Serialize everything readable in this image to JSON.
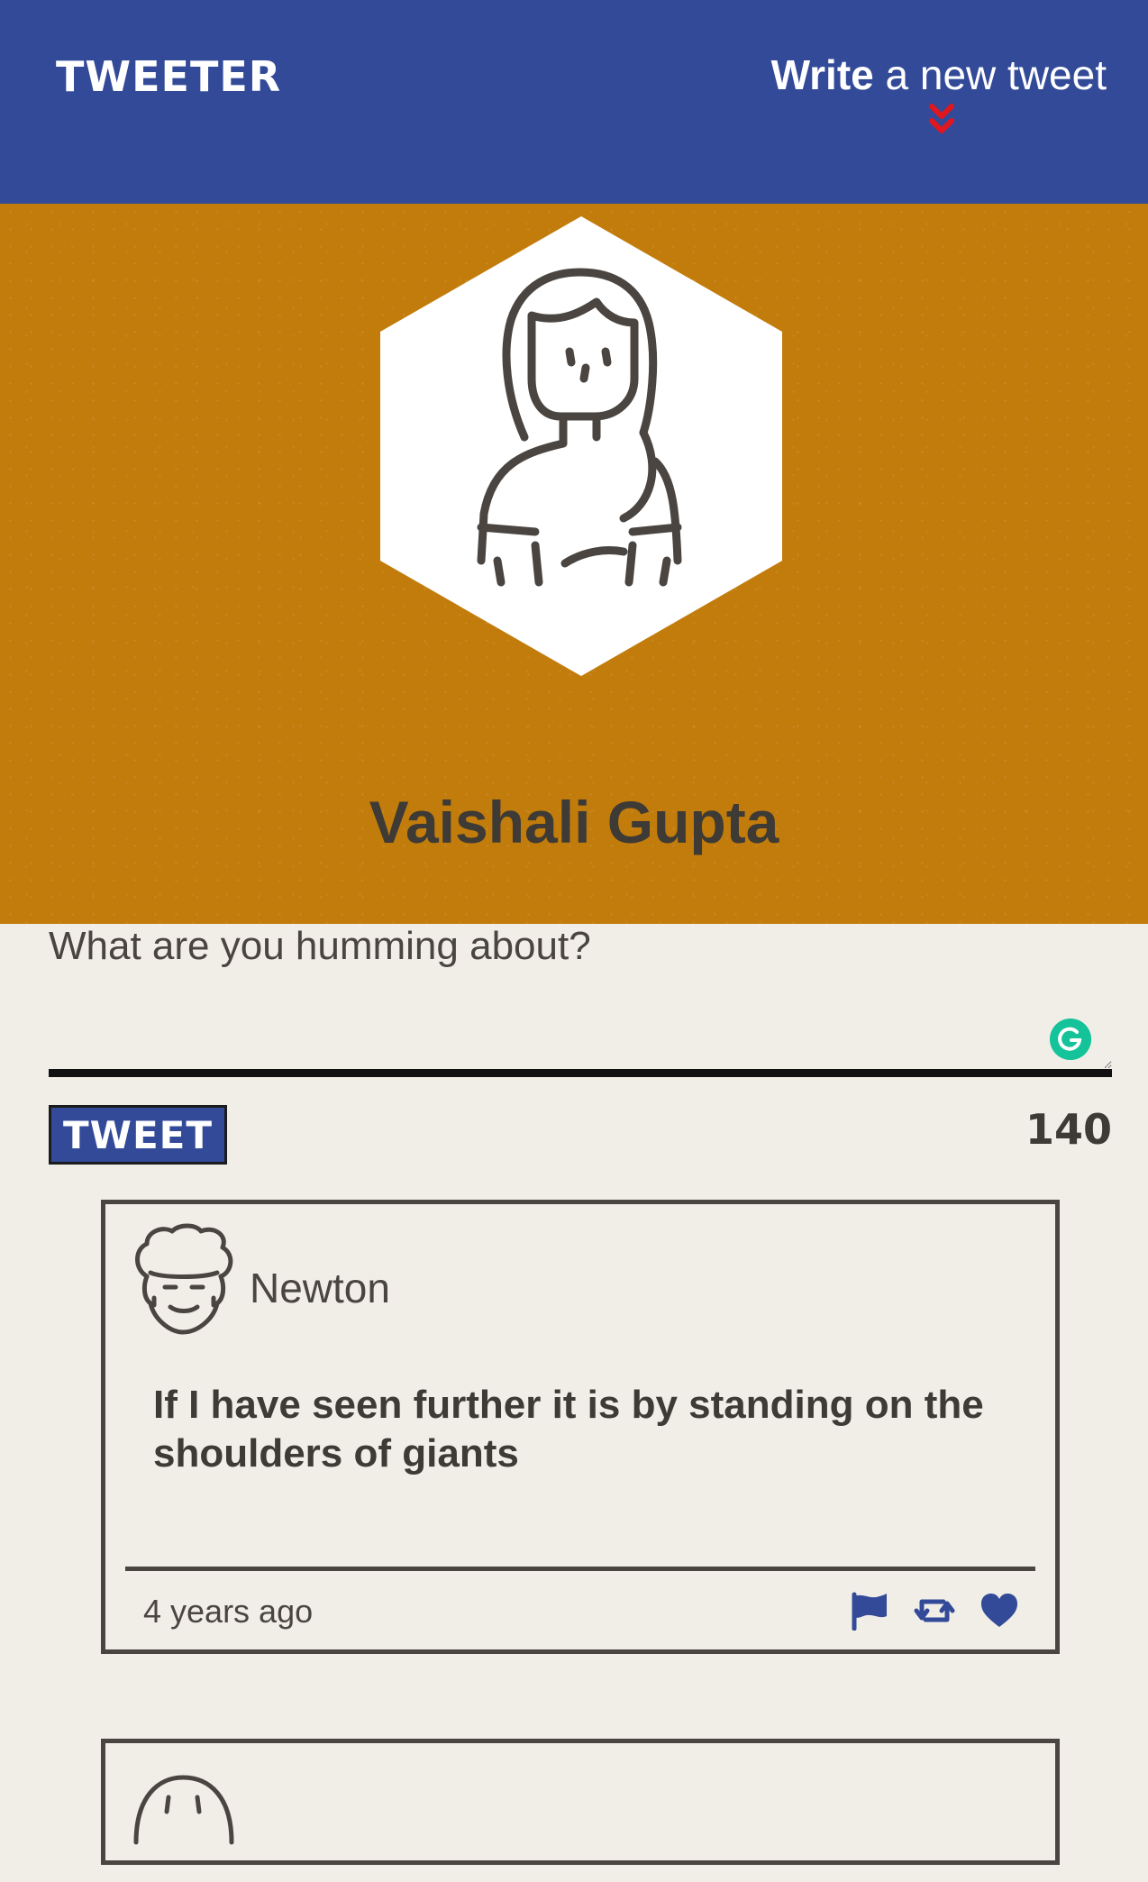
{
  "nav": {
    "brand": "TWEETER",
    "compose_toggle": {
      "strong": "Write",
      "light": " a new tweet",
      "icon": "double-chevron-down-icon",
      "icon_color": "#e0171e"
    },
    "background": "#324a98"
  },
  "profile": {
    "name": "Vaishali Gupta",
    "avatar_icon": "woman-avatar-icon",
    "background": "#c27c0c"
  },
  "compose": {
    "placeholder": "What are you humming about?",
    "value": "",
    "tweet_button": "TWEET",
    "char_counter": "140",
    "grammarly_icon": "grammarly-icon"
  },
  "tweets": [
    {
      "author": "Newton",
      "avatar_icon": "curly-hair-man-avatar-icon",
      "content": "If I have seen further it is by standing on the shoulders of giants",
      "time": "4 years ago",
      "actions": [
        "flag-icon",
        "retweet-icon",
        "heart-icon"
      ]
    },
    {
      "avatar_icon": "avatar-icon"
    }
  ],
  "colors": {
    "accent": "#324a98",
    "text": "#4a4540",
    "page_bg": "#f1eee8"
  }
}
